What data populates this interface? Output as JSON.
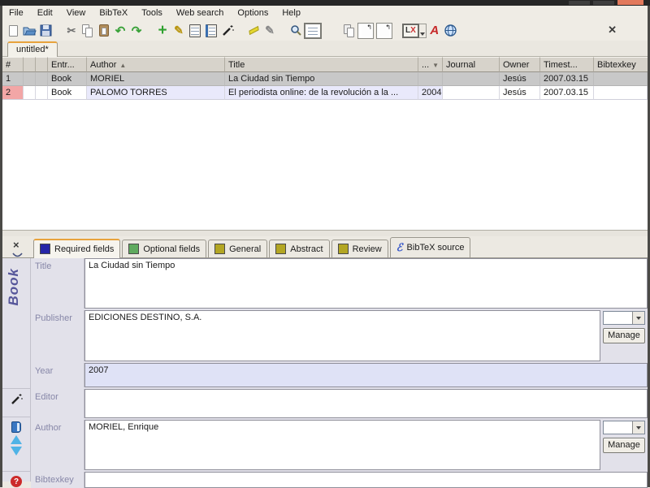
{
  "colors": {
    "accent_tab_orange": "#e8a33d",
    "selected_row_gray": "#c8c8c8",
    "required_cell_lavender": "#e9e9fb",
    "incomplete_flag_red": "#f2a6a6",
    "year_field_highlight": "#dfe2f6",
    "required_tab_square": "#2626a8",
    "optional_tab_square": "#5faa5f",
    "general_tab_square": "#b3a623",
    "vertical_type_label": "#56569a"
  },
  "menu": {
    "items": [
      "File",
      "Edit",
      "View",
      "BibTeX",
      "Tools",
      "Web search",
      "Options",
      "Help"
    ]
  },
  "toolbar": {
    "lyx_l": "L",
    "lyx_x": "X",
    "icons": [
      "new-database",
      "open-database",
      "save-database",
      "cut",
      "copy",
      "paste",
      "undo",
      "redo",
      "new-entry",
      "edit-entry",
      "show-required",
      "show-optional",
      "wizard",
      "mark-entries",
      "unmark-entries",
      "search",
      "toggle-preview",
      "copy-key",
      "import-entries",
      "export-entries",
      "push-to-lyx",
      "open-pdf",
      "web-fetch",
      "close-toolbar"
    ]
  },
  "file_tab": {
    "label": "untitled*"
  },
  "table": {
    "columns": [
      "#",
      "",
      "",
      "Entr...",
      "Author",
      "Title",
      "...",
      "Journal",
      "Owner",
      "Timest...",
      "Bibtexkey"
    ],
    "sort": {
      "author_indicator": "▲",
      "year_indicator": "▼"
    },
    "rows": [
      {
        "num": "1",
        "entrytype": "Book",
        "author": "MORIEL",
        "title": "La Ciudad sin Tiempo",
        "year": "",
        "journal": "",
        "owner": "Jesús",
        "timestamp": "2007.03.15",
        "bibtexkey": "",
        "selected": true
      },
      {
        "num": "2",
        "entrytype": "Book",
        "author": "PALOMO TORRES",
        "title": "El periodista online: de la revolución a la ...",
        "year": "2004",
        "journal": "",
        "owner": "Jesús",
        "timestamp": "2007.03.15",
        "bibtexkey": "",
        "selected": false
      }
    ]
  },
  "editor": {
    "entry_type_vertical": "Book",
    "close_glyph": "×",
    "tabs": [
      {
        "label": "Required fields",
        "active": true,
        "square_style": "background:#2626a8"
      },
      {
        "label": "Optional fields",
        "active": false,
        "square_style": "background:#5faa5f"
      },
      {
        "label": "General",
        "active": false,
        "square_style": "background:#b3a623"
      },
      {
        "label": "Abstract",
        "active": false,
        "square_style": "background:#b3a623"
      },
      {
        "label": "Review",
        "active": false,
        "square_style": "background:#b3a623"
      },
      {
        "label": "BibTeX source",
        "active": false,
        "icon": "bibtex-source-icon"
      }
    ],
    "fields": {
      "title": {
        "label": "Title",
        "value": "La Ciudad sin Tiempo"
      },
      "publisher": {
        "label": "Publisher",
        "value": "EDICIONES DESTINO, S.A."
      },
      "year": {
        "label": "Year",
        "value": "2007"
      },
      "editor": {
        "label": "Editor",
        "value": ""
      },
      "author": {
        "label": "Author",
        "value": "MORIEL, Enrique"
      },
      "bibtexkey": {
        "label": "Bibtexkey",
        "value": ""
      }
    },
    "manage_label": "Manage",
    "side_icons": [
      "generate-key-wand",
      "notebook",
      "prev-entry",
      "next-entry",
      "help"
    ]
  }
}
